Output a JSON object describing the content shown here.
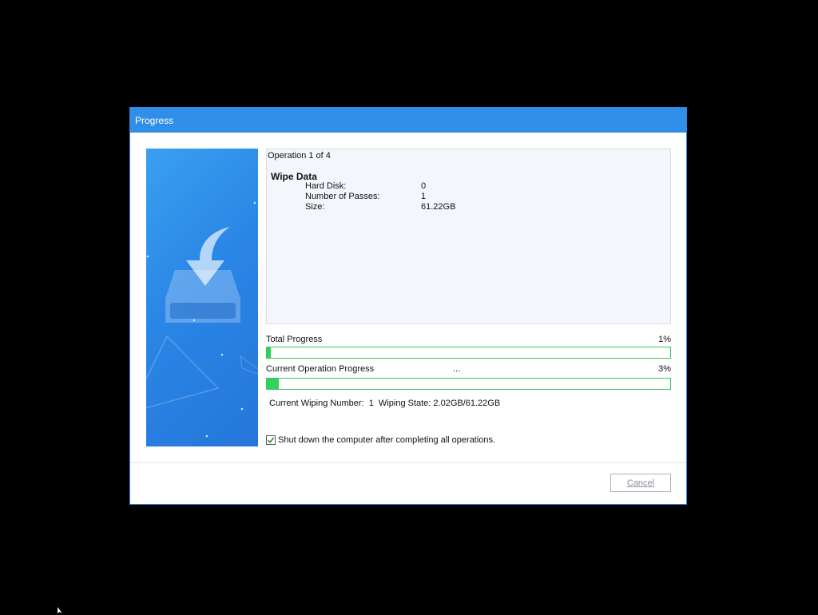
{
  "dialog": {
    "title": "Progress",
    "operation": {
      "count_text": "Operation 1 of 4",
      "name": "Wipe Data",
      "details": [
        {
          "label": "Hard Disk:",
          "value": "0"
        },
        {
          "label": "Number of Passes:",
          "value": "1"
        },
        {
          "label": "Size:",
          "value": "61.22GB"
        }
      ]
    },
    "total_progress": {
      "label": "Total Progress",
      "percent_text": "1%",
      "fraction": 0.01
    },
    "current_progress": {
      "label": "Current Operation Progress",
      "ellipsis": "...",
      "percent_text": "3%",
      "fraction": 0.03
    },
    "wiping_status": "Current Wiping Number:  1  Wiping State: 2.02GB/61.22GB",
    "shutdown_checkbox": {
      "checked": true,
      "label": "Shut down the computer after completing all operations."
    },
    "cancel_label": "Cancel"
  },
  "colors": {
    "titlebar": "#2f8fe8",
    "progress_fill": "#2fd25b",
    "progress_border": "#3cc45a",
    "side_panel": "#2a86e6"
  },
  "icons": {
    "side_illustration": "drive-download-icon",
    "checkbox_mark": "checkmark-icon",
    "mouse_cursor": "cursor-arrow-icon"
  }
}
